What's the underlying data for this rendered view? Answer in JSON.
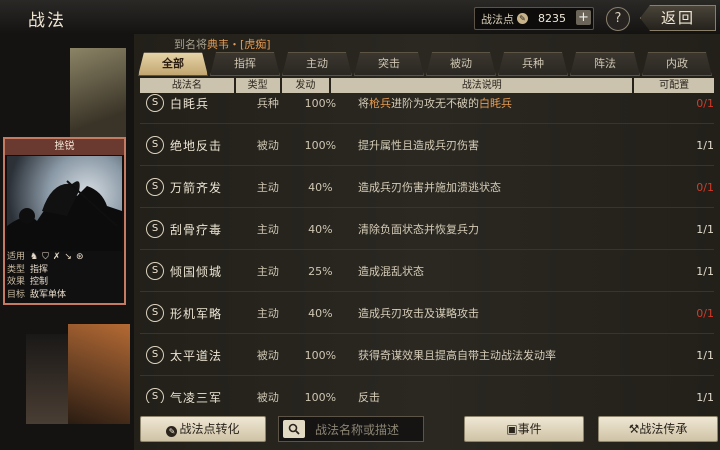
{
  "header": {
    "title": "战法",
    "points_label": "战法点",
    "points_value": "8235",
    "plus_label": "+",
    "help_label": "?",
    "back_label": "返回"
  },
  "hint": {
    "prefix": "到名将",
    "name": "典韦",
    "suffix": "・[虎痴]"
  },
  "tabs": [
    "全部",
    "指挥",
    "主动",
    "突击",
    "被动",
    "兵种",
    "阵法",
    "内政"
  ],
  "columns": [
    "战法名",
    "类型",
    "发动",
    "战法说明",
    "可配置"
  ],
  "card": {
    "name": "挫锐",
    "stats": [
      {
        "key": "适用",
        "value": ""
      },
      {
        "key": "类型",
        "value": "指挥"
      },
      {
        "key": "效果",
        "value": "控制"
      },
      {
        "key": "目标",
        "value": "敌军单体"
      }
    ]
  },
  "rows": [
    {
      "name": "白眊兵",
      "type": "兵种",
      "rate": "100%",
      "desc_pre": "将",
      "desc_hl": "枪兵",
      "desc_mid": "进阶为攻无不破的",
      "desc_hl2": "白眊兵",
      "cfg": "0/1",
      "cfg_red": true
    },
    {
      "name": "绝地反击",
      "type": "被动",
      "rate": "100%",
      "desc_pre": "提升属性且造成兵刃伤害",
      "desc_hl": "",
      "desc_mid": "",
      "desc_hl2": "",
      "cfg": "1/1",
      "cfg_red": false
    },
    {
      "name": "万箭齐发",
      "type": "主动",
      "rate": "40%",
      "desc_pre": "造成兵刃伤害并施加溃逃状态",
      "desc_hl": "",
      "desc_mid": "",
      "desc_hl2": "",
      "cfg": "0/1",
      "cfg_red": true
    },
    {
      "name": "刮骨疗毒",
      "type": "主动",
      "rate": "40%",
      "desc_pre": "清除负面状态并恢复兵力",
      "desc_hl": "",
      "desc_mid": "",
      "desc_hl2": "",
      "cfg": "1/1",
      "cfg_red": false
    },
    {
      "name": "倾国倾城",
      "type": "主动",
      "rate": "25%",
      "desc_pre": "造成混乱状态",
      "desc_hl": "",
      "desc_mid": "",
      "desc_hl2": "",
      "cfg": "1/1",
      "cfg_red": false
    },
    {
      "name": "形机军略",
      "type": "主动",
      "rate": "40%",
      "desc_pre": "造成兵刃攻击及谋略攻击",
      "desc_hl": "",
      "desc_mid": "",
      "desc_hl2": "",
      "cfg": "0/1",
      "cfg_red": true
    },
    {
      "name": "太平道法",
      "type": "被动",
      "rate": "100%",
      "desc_pre": "获得奇谋效果且提高自带主动战法发动率",
      "desc_hl": "",
      "desc_mid": "",
      "desc_hl2": "",
      "cfg": "1/1",
      "cfg_red": false
    },
    {
      "name": "气凌三军",
      "type": "被动",
      "rate": "100%",
      "desc_pre": "反击",
      "desc_hl": "",
      "desc_mid": "",
      "desc_hl2": "",
      "cfg": "1/1",
      "cfg_red": false
    }
  ],
  "bottom": {
    "convert_label": "战法点转化",
    "search_placeholder": "战法名称或描述",
    "event_label": "事件",
    "inherit_label": "战法传承"
  },
  "colors": {
    "accent": "#e49a52",
    "red": "#d23b2a",
    "tab_active": "#e6d4a7"
  }
}
